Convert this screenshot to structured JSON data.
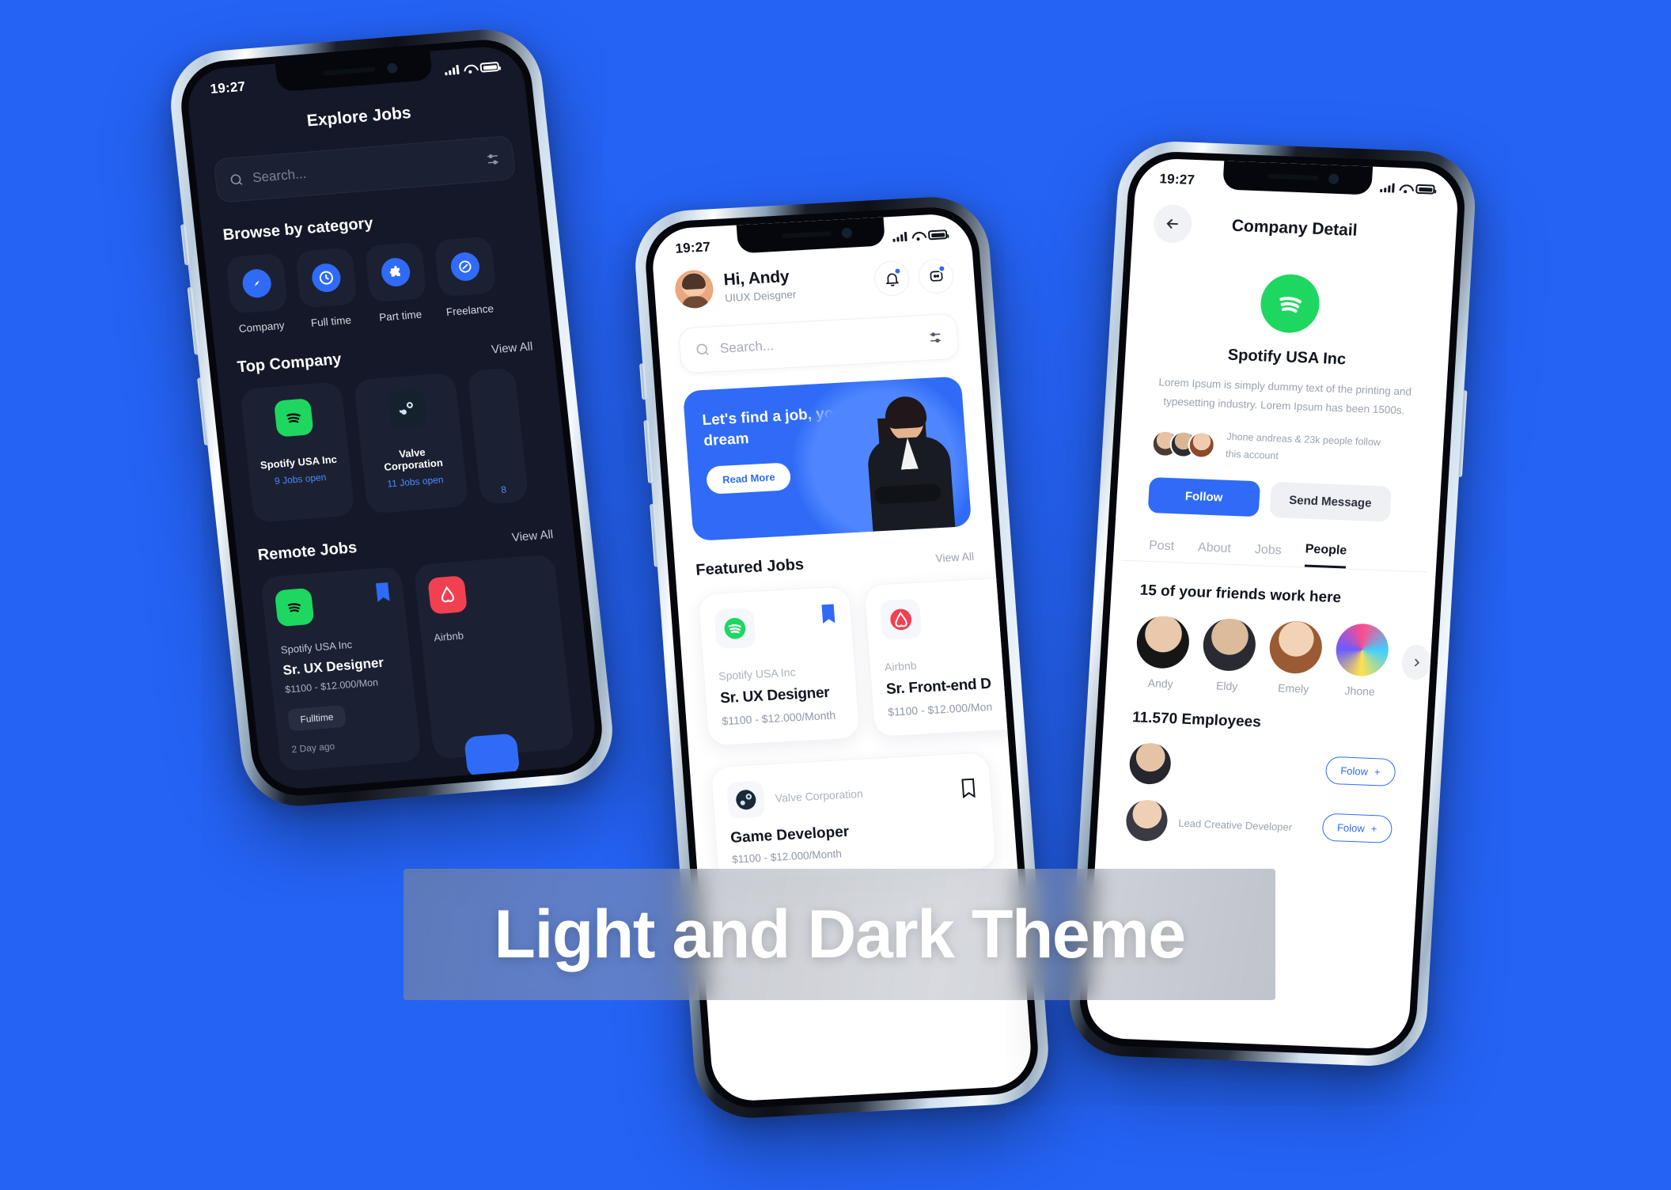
{
  "background_color": "#2563f5",
  "overlay": {
    "title": "Light and Dark Theme"
  },
  "dark_phone": {
    "status": {
      "time": "19:27"
    },
    "title": "Explore Jobs",
    "search": {
      "placeholder": "Search..."
    },
    "browse_title": "Browse by category",
    "categories": [
      {
        "label": "Company",
        "icon": "compass-icon"
      },
      {
        "label": "Full time",
        "icon": "clock-icon"
      },
      {
        "label": "Part time",
        "icon": "puzzle-icon"
      },
      {
        "label": "Freelance",
        "icon": "circle-slash-icon"
      }
    ],
    "top_company": {
      "title": "Top Company",
      "view_all": "View All"
    },
    "companies": [
      {
        "name": "Spotify USA Inc",
        "jobs": "9 Jobs open",
        "logo": "spotify-logo",
        "color": "#1ed760"
      },
      {
        "name": "Valve Corporation",
        "jobs": "11 Jobs open",
        "logo": "steam-logo",
        "color": "#1b2838"
      },
      {
        "name": "",
        "jobs": "8",
        "logo": "partial-logo",
        "color": "#e5e7eb"
      }
    ],
    "remote_jobs": {
      "title": "Remote Jobs",
      "view_all": "View All"
    },
    "jobs": [
      {
        "company": "Spotify USA Inc",
        "title": "Sr. UX Designer",
        "salary": "$1100 - $12.000/Mon",
        "tag": "Fulltime",
        "ago": "2 Day ago",
        "logo": "spotify-logo"
      },
      {
        "company": "Airbnb",
        "title": "",
        "salary": "",
        "tag": "",
        "ago": "",
        "logo": "airbnb-logo"
      }
    ]
  },
  "mid_phone": {
    "status": {
      "time": "19:27"
    },
    "greeting": {
      "hello": "Hi, Andy",
      "role": "UIUX Deisgner"
    },
    "actions": [
      {
        "name": "notifications",
        "icon": "bell-icon"
      },
      {
        "name": "messages",
        "icon": "message-icon"
      }
    ],
    "search": {
      "placeholder": "Search..."
    },
    "banner": {
      "title": "Let's find a job, your dream",
      "cta": "Read More"
    },
    "featured": {
      "title": "Featured Jobs",
      "view_all": "View All"
    },
    "featured_jobs": [
      {
        "company": "Spotify USA Inc",
        "title": "Sr. UX Designer",
        "salary": "$1100 - $12.000/Month",
        "logo": "spotify-logo",
        "bookmarked": true
      },
      {
        "company": "Airbnb",
        "title": "Sr. Front-end D",
        "salary": "$1100 - $12.000/Mon",
        "logo": "airbnb-logo",
        "bookmarked": false
      }
    ],
    "list_job": {
      "company": "Valve Corporation",
      "title": "Game Developer",
      "salary": "$1100 - $12.000/Month",
      "logo": "steam-logo"
    }
  },
  "right_phone": {
    "status": {
      "time": "19:27"
    },
    "title": "Company Detail",
    "back_icon": "arrow-left-icon",
    "company": {
      "name": "Spotify USA Inc",
      "logo": "spotify-logo",
      "description": "Lorem Ipsum is simply dummy text of the printing and typesetting industry. Lorem Ipsum has been 1500s."
    },
    "followers_text": "Jhone andreas & 23k people follow this account",
    "buttons": {
      "follow": "Follow",
      "message": "Send Message"
    },
    "tabs": [
      {
        "label": "Post",
        "active": false
      },
      {
        "label": "About",
        "active": false
      },
      {
        "label": "Jobs",
        "active": false
      },
      {
        "label": "People",
        "active": true
      }
    ],
    "friends_title": "15 of your friends work here",
    "friends": [
      {
        "name": "Andy"
      },
      {
        "name": "Eldy"
      },
      {
        "name": "Emely"
      },
      {
        "name": "Jhone"
      }
    ],
    "employees_title": "11.570 Employees",
    "employees": [
      {
        "name": "",
        "role": "",
        "follow": "Folow"
      },
      {
        "name": "",
        "role": "Lead Creative Developer",
        "follow": "Folow"
      }
    ]
  }
}
